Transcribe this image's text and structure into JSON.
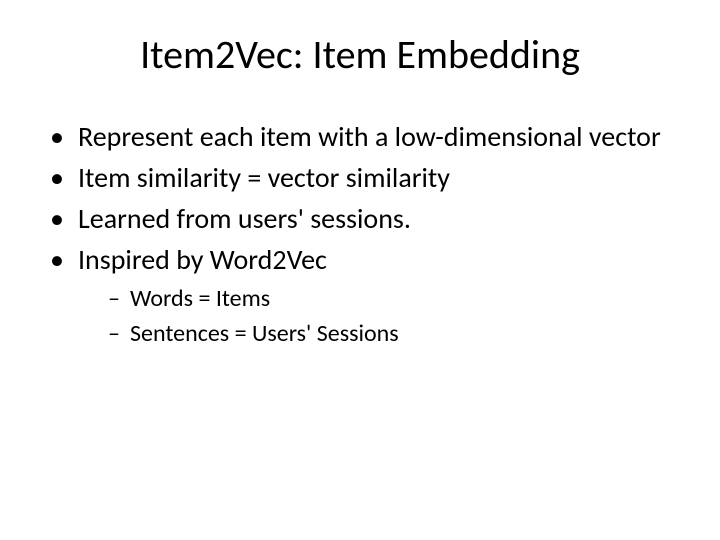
{
  "title": "Item2Vec: Item Embedding",
  "bullets": [
    "Represent each item with a low-dimensional vector",
    "Item similarity = vector similarity",
    "Learned from users' sessions.",
    "Inspired by Word2Vec"
  ],
  "subbullets": [
    "Words = Items",
    "Sentences = Users' Sessions"
  ]
}
